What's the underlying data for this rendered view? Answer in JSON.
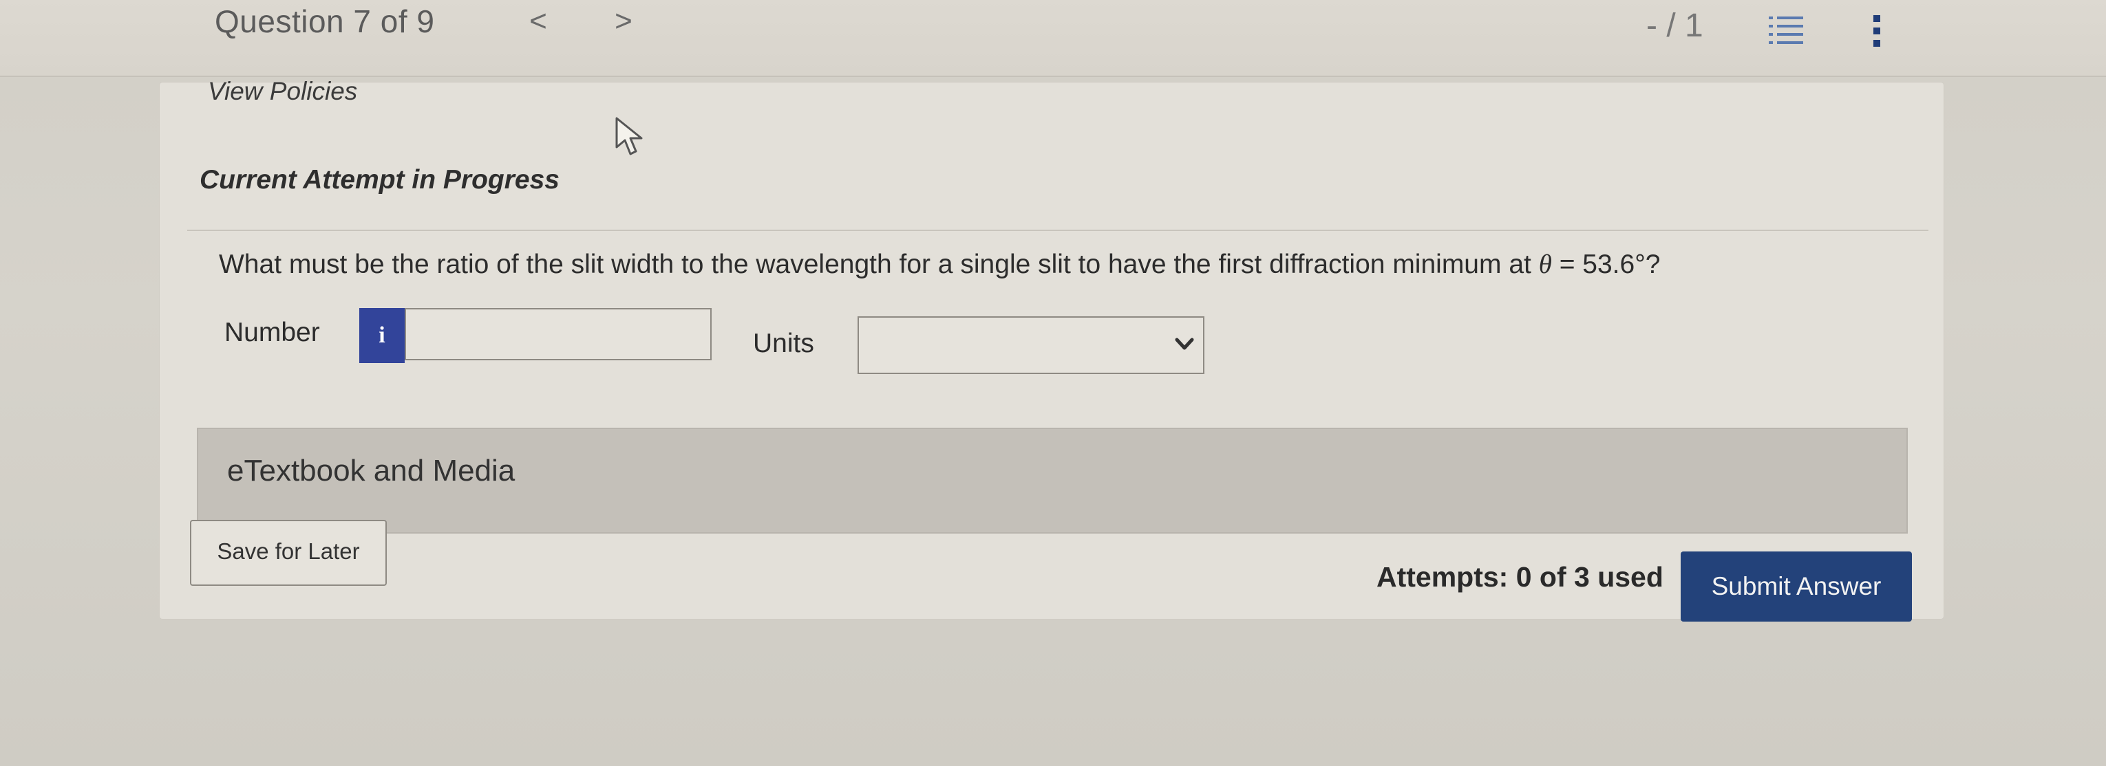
{
  "header": {
    "question_label": "Question 7 of 9",
    "prev_glyph": "<",
    "next_glyph": ">",
    "score": "- / 1",
    "list_icon": "list-icon",
    "more_icon": "more-vertical-icon"
  },
  "card": {
    "view_policies": "View Policies",
    "attempt_heading": "Current Attempt in Progress",
    "question_before": "What must be the ratio of the slit width to the wavelength for a single slit to have the first diffraction minimum at ",
    "question_symbol": "θ",
    "question_after": " = 53.6°?"
  },
  "answer": {
    "number_label": "Number",
    "info_glyph": "i",
    "number_value": "",
    "units_label": "Units",
    "units_value": ""
  },
  "etextbook": {
    "label": "eTextbook and Media"
  },
  "footer": {
    "save_label": "Save for Later",
    "attempts_text": "Attempts: 0 of 3 used",
    "submit_label": "Submit Answer"
  },
  "colors": {
    "info_button": "#32449a",
    "submit_button": "#23427a",
    "etextbook_bar": "#c4c0b9"
  }
}
